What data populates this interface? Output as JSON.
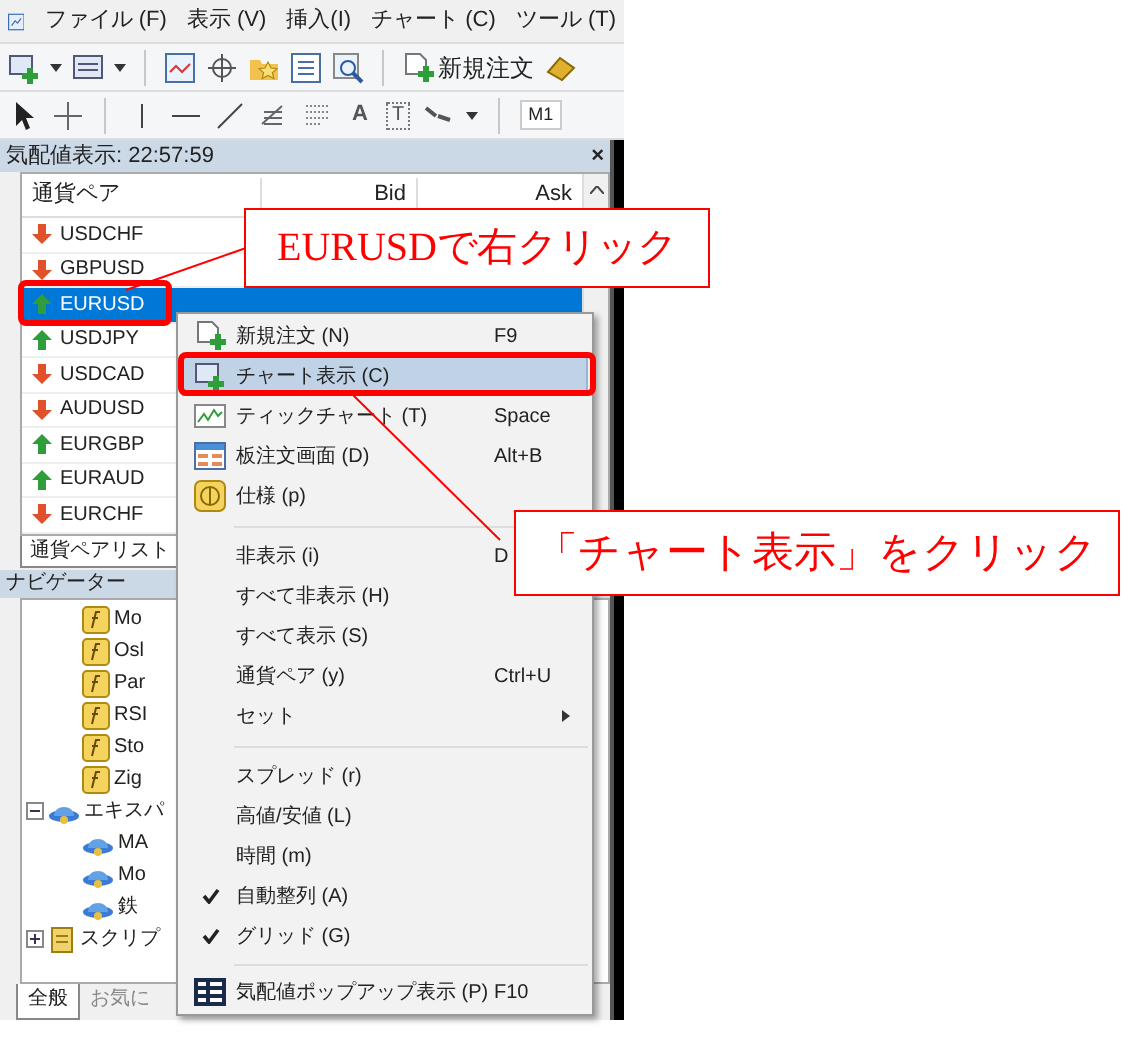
{
  "menu_bar": {
    "items": [
      "ファイル (F)",
      "表示 (V)",
      "挿入(I)",
      "チャート (C)",
      "ツール (T)"
    ]
  },
  "toolbar": {
    "new_order": "新規注文"
  },
  "toolbar2": {
    "text_tool": "A",
    "label_tool": "T",
    "timeframe": "M1"
  },
  "market_watch": {
    "title": "気配値表示: 22:57:59",
    "close": "×",
    "columns": [
      "通貨ペア",
      "Bid",
      "Ask"
    ],
    "rows": [
      {
        "symbol": "USDCHF",
        "rising": false,
        "selected": false
      },
      {
        "symbol": "GBPUSD",
        "rising": false,
        "selected": false
      },
      {
        "symbol": "EURUSD",
        "rising": true,
        "selected": true
      },
      {
        "symbol": "USDJPY",
        "rising": true,
        "selected": false
      },
      {
        "symbol": "USDCAD",
        "rising": false,
        "selected": false
      },
      {
        "symbol": "AUDUSD",
        "rising": false,
        "selected": false
      },
      {
        "symbol": "EURGBP",
        "rising": true,
        "selected": false
      },
      {
        "symbol": "EURAUD",
        "rising": true,
        "selected": false
      },
      {
        "symbol": "EURCHF",
        "rising": false,
        "selected": false
      }
    ],
    "tab": "通貨ペアリスト"
  },
  "navigator": {
    "title": "ナビゲーター",
    "nodes": [
      {
        "label": "Mo",
        "kind": "indicator"
      },
      {
        "label": "Osl",
        "kind": "indicator"
      },
      {
        "label": "Par",
        "kind": "indicator"
      },
      {
        "label": "RSI",
        "kind": "indicator"
      },
      {
        "label": "Sto",
        "kind": "indicator"
      },
      {
        "label": "Zig",
        "kind": "indicator"
      },
      {
        "label": "エキスパ",
        "kind": "experts",
        "expanded": true,
        "children": [
          {
            "label": "MA",
            "kind": "expert"
          },
          {
            "label": "Mo",
            "kind": "expert"
          },
          {
            "label": "鉄",
            "kind": "expert"
          }
        ]
      },
      {
        "label": "スクリプ",
        "kind": "scripts",
        "expanded": false
      }
    ],
    "tabs": [
      {
        "label": "全般",
        "selected": true
      },
      {
        "label": "お気に",
        "selected": false
      }
    ]
  },
  "context_menu": {
    "sections": [
      [
        {
          "label": "新規注文 (N)",
          "shortcut": "F9",
          "checked": false,
          "selected": false
        },
        {
          "label": "チャート表示 (C)",
          "checked": false,
          "selected": true
        },
        {
          "label": "ティックチャート (T)",
          "shortcut": "Space",
          "checked": false,
          "selected": false
        },
        {
          "label": "板注文画面 (D)",
          "shortcut": "Alt+B",
          "checked": false,
          "selected": false
        },
        {
          "label": "仕様 (p)",
          "checked": false,
          "selected": false
        }
      ],
      [
        {
          "label": "非表示 (i)",
          "shortcut": "D",
          "checked": false,
          "selected": false
        },
        {
          "label": "すべて非表示 (H)",
          "checked": false,
          "selected": false
        },
        {
          "label": "すべて表示 (S)",
          "checked": false,
          "selected": false
        },
        {
          "label": "通貨ペア (y)",
          "shortcut": "Ctrl+U",
          "checked": false,
          "selected": false
        },
        {
          "label": "セット",
          "submenu": true,
          "checked": false,
          "selected": false
        }
      ],
      [
        {
          "label": "スプレッド (r)",
          "checked": false,
          "selected": false
        },
        {
          "label": "高値/安値 (L)",
          "checked": false,
          "selected": false
        },
        {
          "label": "時間 (m)",
          "checked": false,
          "selected": false
        },
        {
          "label": "自動整列 (A)",
          "checked": true,
          "selected": false
        },
        {
          "label": "グリッド (G)",
          "checked": true,
          "selected": false
        }
      ],
      [
        {
          "label": "気配値ポップアップ表示 (P)",
          "shortcut": "F10",
          "checked": false,
          "selected": false
        }
      ]
    ]
  },
  "annotations": [
    {
      "text": "EURUSDで右クリック"
    },
    {
      "text": "「チャート表示」をクリック"
    }
  ]
}
